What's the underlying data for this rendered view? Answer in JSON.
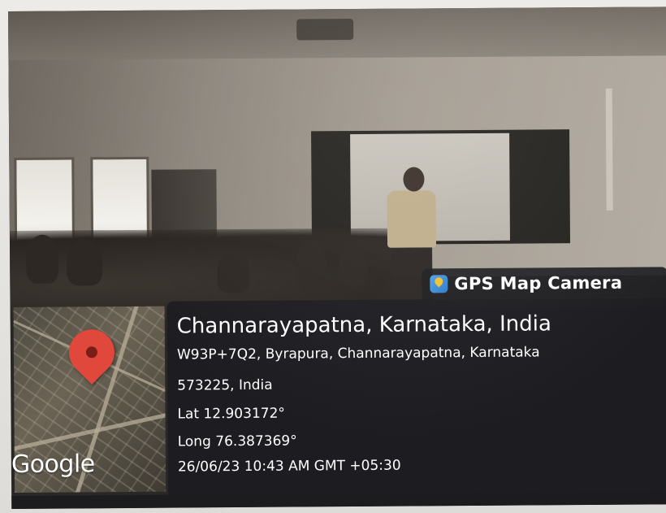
{
  "gps_tag": {
    "label": "GPS Map Camera",
    "icon": "gps-map-camera-app-icon"
  },
  "map": {
    "logo_text": "Google",
    "pin_icon": "map-pin-icon",
    "pin_color": "#e0483c"
  },
  "location": {
    "title": "Channarayapatna, Karnataka, India",
    "address_line_1": "W93P+7Q2, Byrapura, Channarayapatna, Karnataka",
    "address_line_2": "573225, India",
    "latitude": "Lat 12.903172°",
    "longitude": "Long 76.387369°",
    "timestamp": "26/06/23 10:43 AM GMT +05:30"
  }
}
